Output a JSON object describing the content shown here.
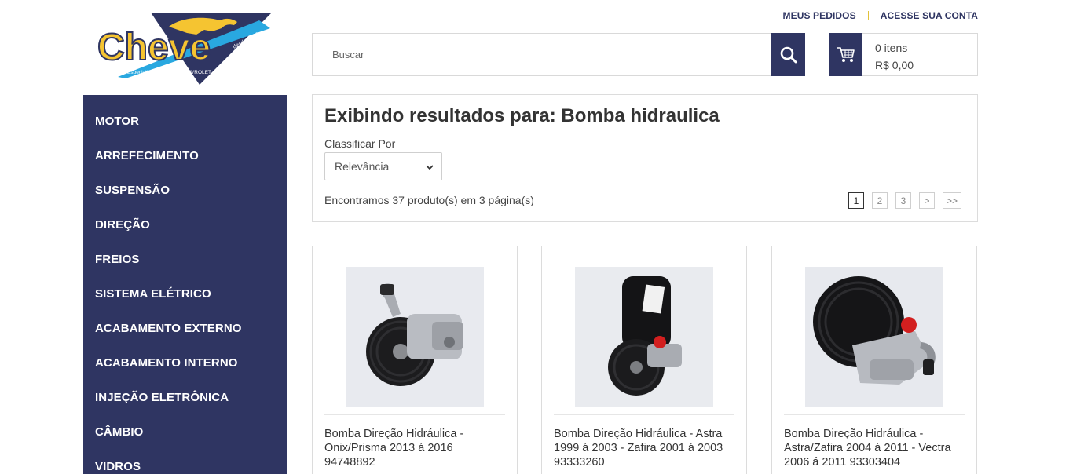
{
  "brand": {
    "logo_text": "Cheve",
    "tagline": "Especialista em Peças CHEVROLET",
    "since": "desde 1989",
    "colors": {
      "navy": "#2f3562",
      "accent_blue": "#29a8e0",
      "logo_yellow": "#f5c431"
    }
  },
  "top_links": {
    "orders": "MEUS PEDIDOS",
    "account": "ACESSE SUA CONTA"
  },
  "search": {
    "placeholder": "Buscar",
    "icon": "search-icon"
  },
  "cart": {
    "items": "0 itens",
    "total": "R$ 0,00",
    "icon": "cart-icon"
  },
  "sidebar": {
    "items": [
      {
        "label": "MOTOR"
      },
      {
        "label": "ARREFECIMENTO"
      },
      {
        "label": "SUSPENSÃO"
      },
      {
        "label": "DIREÇÃO"
      },
      {
        "label": "FREIOS"
      },
      {
        "label": "SISTEMA ELÉTRICO"
      },
      {
        "label": "ACABAMENTO EXTERNO"
      },
      {
        "label": "ACABAMENTO INTERNO"
      },
      {
        "label": "INJEÇÃO ELETRÔNICA"
      },
      {
        "label": "CÂMBIO"
      },
      {
        "label": "VIDROS"
      }
    ]
  },
  "results": {
    "heading": "Exibindo resultados para: Bomba hidraulica",
    "sort_label": "Classificar Por",
    "sort_selected": "Relevância",
    "found_text": "Encontramos 37 produto(s) em 3 página(s)",
    "pages": [
      "1",
      "2",
      "3",
      ">",
      ">>"
    ],
    "current_page": "1"
  },
  "products": [
    {
      "title": "Bomba Direção Hidráulica - Onix/Prisma 2013 á 2016 94748892"
    },
    {
      "title": "Bomba Direção Hidráulica - Astra 1999 á 2003 - Zafira 2001 á 2003 93333260"
    },
    {
      "title": "Bomba Direção Hidráulica - Astra/Zafira 2004 á 2011 - Vectra 2006 á 2011 93303404"
    }
  ]
}
